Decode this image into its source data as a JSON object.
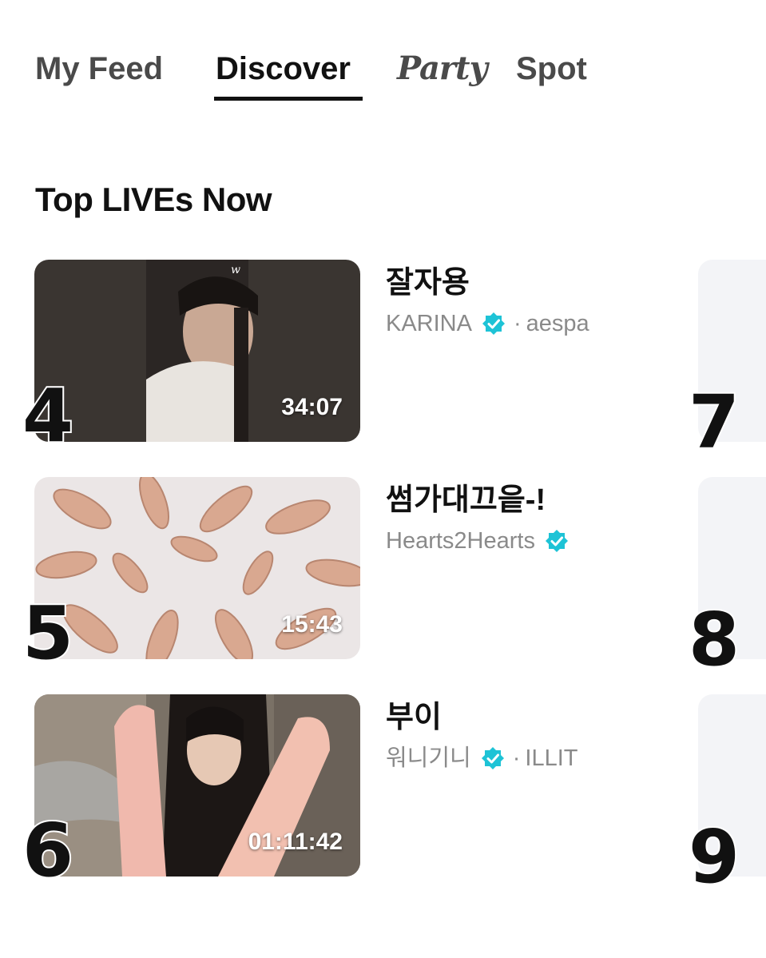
{
  "tabs": [
    {
      "label": "My Feed",
      "active": false
    },
    {
      "label": "Discover",
      "active": true
    },
    {
      "label": "Party",
      "active": false
    },
    {
      "label": "Spot",
      "active": false
    }
  ],
  "section": {
    "title": "Top LIVEs Now"
  },
  "lives": [
    {
      "rank": "4",
      "title": "잘자용",
      "artist": "KARINA",
      "group": "aespa",
      "duration": "34:07",
      "verified": true
    },
    {
      "rank": "5",
      "title": "썸가대끄읕-!",
      "artist": "Hearts2Hearts",
      "group": "",
      "duration": "15:43",
      "verified": true
    },
    {
      "rank": "6",
      "title": "부이",
      "artist": "워니기니",
      "group": "ILLIT",
      "duration": "01:11:42",
      "verified": true
    }
  ],
  "side_lives": [
    {
      "rank": "7"
    },
    {
      "rank": "8"
    },
    {
      "rank": "9"
    }
  ],
  "colors": {
    "verified": "#1ec3d6",
    "text": "#111111",
    "muted": "#8a8a8a",
    "side_card": "#f3f4f7"
  }
}
